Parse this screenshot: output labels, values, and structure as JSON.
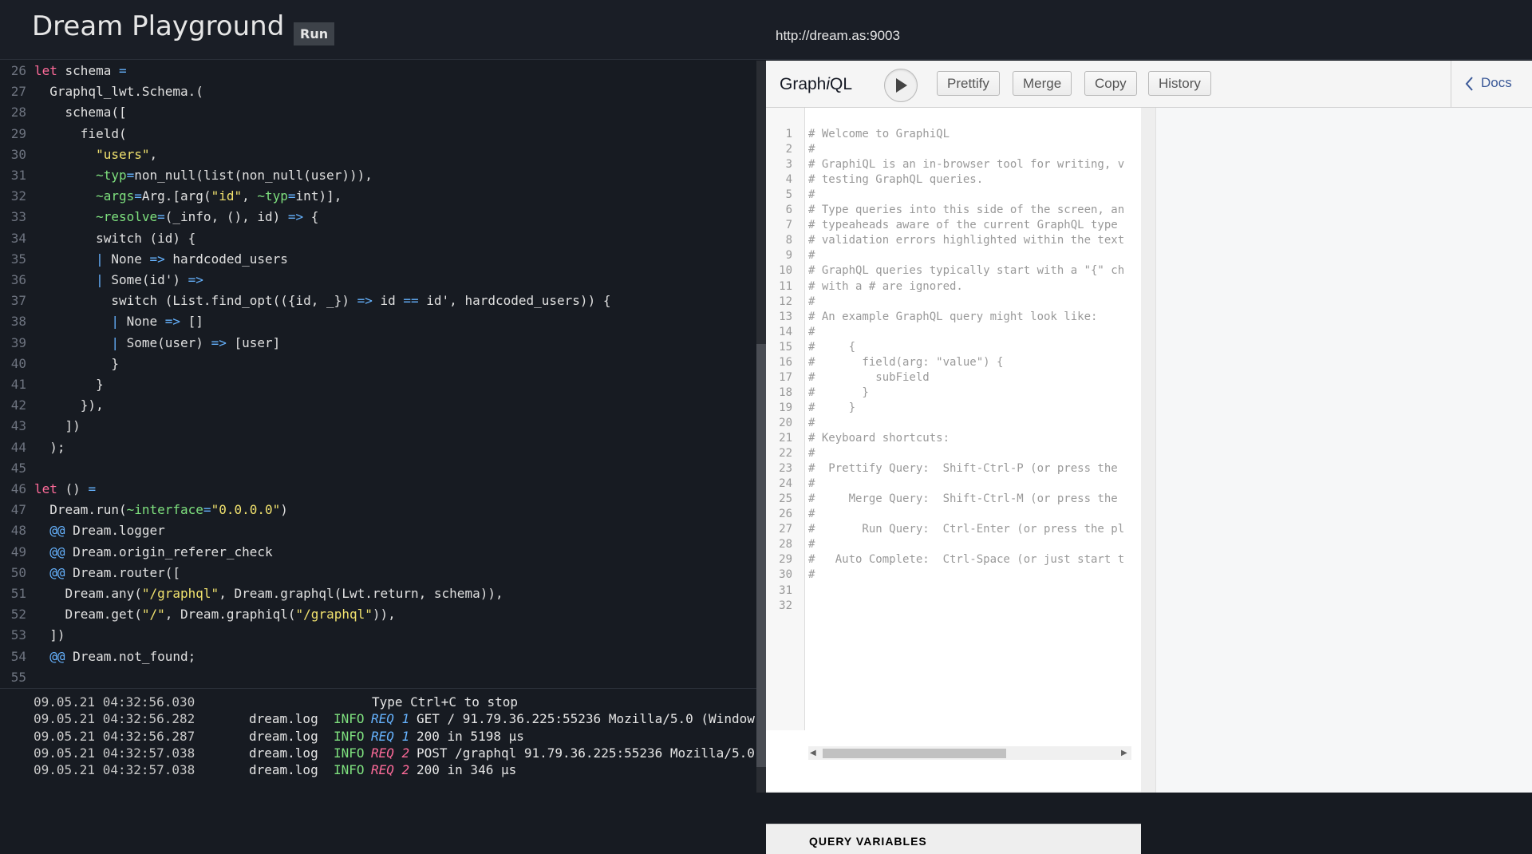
{
  "header": {
    "title": "Dream Playground",
    "run_label": "Run",
    "url": "http://dream.as:9003"
  },
  "editor": {
    "lines": [
      {
        "n": "26",
        "parts": [
          [
            "kw",
            "let"
          ],
          [
            "txt",
            " schema "
          ],
          [
            "op",
            "="
          ]
        ]
      },
      {
        "n": "27",
        "parts": [
          [
            "txt",
            "  Graphql_lwt.Schema.("
          ]
        ]
      },
      {
        "n": "28",
        "parts": [
          [
            "txt",
            "    schema(["
          ]
        ]
      },
      {
        "n": "29",
        "parts": [
          [
            "txt",
            "      field("
          ]
        ]
      },
      {
        "n": "30",
        "parts": [
          [
            "txt",
            "        "
          ],
          [
            "str",
            "\"users\""
          ],
          [
            "txt",
            ","
          ]
        ]
      },
      {
        "n": "31",
        "parts": [
          [
            "txt",
            "        "
          ],
          [
            "lab",
            "~typ"
          ],
          [
            "op",
            "="
          ],
          [
            "txt",
            "non_null(list(non_null(user))),"
          ]
        ]
      },
      {
        "n": "32",
        "parts": [
          [
            "txt",
            "        "
          ],
          [
            "lab",
            "~args"
          ],
          [
            "op",
            "="
          ],
          [
            "txt",
            "Arg.[arg("
          ],
          [
            "str",
            "\"id\""
          ],
          [
            "txt",
            ", "
          ],
          [
            "lab",
            "~typ"
          ],
          [
            "op",
            "="
          ],
          [
            "txt",
            "int)],"
          ]
        ]
      },
      {
        "n": "33",
        "parts": [
          [
            "txt",
            "        "
          ],
          [
            "lab",
            "~resolve"
          ],
          [
            "op",
            "="
          ],
          [
            "txt",
            "(_info, (), id) "
          ],
          [
            "op",
            "=>"
          ],
          [
            "txt",
            " {"
          ]
        ]
      },
      {
        "n": "34",
        "parts": [
          [
            "txt",
            "        switch (id) {"
          ]
        ]
      },
      {
        "n": "35",
        "parts": [
          [
            "txt",
            "        "
          ],
          [
            "op",
            "|"
          ],
          [
            "txt",
            " None "
          ],
          [
            "op",
            "=>"
          ],
          [
            "txt",
            " hardcoded_users"
          ]
        ]
      },
      {
        "n": "36",
        "parts": [
          [
            "txt",
            "        "
          ],
          [
            "op",
            "|"
          ],
          [
            "txt",
            " Some(id') "
          ],
          [
            "op",
            "=>"
          ]
        ]
      },
      {
        "n": "37",
        "parts": [
          [
            "txt",
            "          switch (List.find_opt(({id, _}) "
          ],
          [
            "op",
            "=>"
          ],
          [
            "txt",
            " id "
          ],
          [
            "op",
            "=="
          ],
          [
            "txt",
            " id', hardcoded_users)) {"
          ]
        ]
      },
      {
        "n": "38",
        "parts": [
          [
            "txt",
            "          "
          ],
          [
            "op",
            "|"
          ],
          [
            "txt",
            " None "
          ],
          [
            "op",
            "=>"
          ],
          [
            "txt",
            " []"
          ]
        ]
      },
      {
        "n": "39",
        "parts": [
          [
            "txt",
            "          "
          ],
          [
            "op",
            "|"
          ],
          [
            "txt",
            " Some(user) "
          ],
          [
            "op",
            "=>"
          ],
          [
            "txt",
            " [user]"
          ]
        ]
      },
      {
        "n": "40",
        "parts": [
          [
            "txt",
            "          }"
          ]
        ]
      },
      {
        "n": "41",
        "parts": [
          [
            "txt",
            "        }"
          ]
        ]
      },
      {
        "n": "42",
        "parts": [
          [
            "txt",
            "      }),"
          ]
        ]
      },
      {
        "n": "43",
        "parts": [
          [
            "txt",
            "    ])"
          ]
        ]
      },
      {
        "n": "44",
        "parts": [
          [
            "txt",
            "  );"
          ]
        ]
      },
      {
        "n": "45",
        "parts": [
          [
            "txt",
            ""
          ]
        ]
      },
      {
        "n": "46",
        "parts": [
          [
            "kw",
            "let"
          ],
          [
            "txt",
            " () "
          ],
          [
            "op",
            "="
          ]
        ]
      },
      {
        "n": "47",
        "parts": [
          [
            "txt",
            "  Dream.run("
          ],
          [
            "lab",
            "~interface"
          ],
          [
            "op",
            "="
          ],
          [
            "str",
            "\"0.0.0.0\""
          ],
          [
            "txt",
            ")"
          ]
        ]
      },
      {
        "n": "48",
        "parts": [
          [
            "txt",
            "  "
          ],
          [
            "op",
            "@@"
          ],
          [
            "txt",
            " Dream.logger"
          ]
        ]
      },
      {
        "n": "49",
        "parts": [
          [
            "txt",
            "  "
          ],
          [
            "op",
            "@@"
          ],
          [
            "txt",
            " Dream.origin_referer_check"
          ]
        ]
      },
      {
        "n": "50",
        "parts": [
          [
            "txt",
            "  "
          ],
          [
            "op",
            "@@"
          ],
          [
            "txt",
            " Dream.router(["
          ]
        ]
      },
      {
        "n": "51",
        "parts": [
          [
            "txt",
            "    Dream.any("
          ],
          [
            "str",
            "\"/graphql\""
          ],
          [
            "txt",
            ", Dream.graphql(Lwt.return, schema)),"
          ]
        ]
      },
      {
        "n": "52",
        "parts": [
          [
            "txt",
            "    Dream.get("
          ],
          [
            "str",
            "\"/\""
          ],
          [
            "txt",
            ", Dream.graphiql("
          ],
          [
            "str",
            "\"/graphql\""
          ],
          [
            "txt",
            ")),"
          ]
        ]
      },
      {
        "n": "53",
        "parts": [
          [
            "txt",
            "  ])"
          ]
        ]
      },
      {
        "n": "54",
        "parts": [
          [
            "txt",
            "  "
          ],
          [
            "op",
            "@@"
          ],
          [
            "txt",
            " Dream.not_found;"
          ]
        ]
      },
      {
        "n": "55",
        "parts": [
          [
            "txt",
            ""
          ]
        ]
      }
    ]
  },
  "log": {
    "lines": [
      {
        "time": "09.05.21 04:32:56.030",
        "source": "",
        "level": "",
        "req": "",
        "req_class": "",
        "message": "Type Ctrl+C to stop"
      },
      {
        "time": "09.05.21 04:32:56.282",
        "source": "dream.log",
        "level": "INFO",
        "req": "REQ 1",
        "req_class": "lreq1",
        "message": "GET / 91.79.36.225:55236 Mozilla/5.0 (Window"
      },
      {
        "time": "09.05.21 04:32:56.287",
        "source": "dream.log",
        "level": "INFO",
        "req": "REQ 1",
        "req_class": "lreq1",
        "message": "200 in 5198 µs"
      },
      {
        "time": "09.05.21 04:32:57.038",
        "source": "dream.log",
        "level": "INFO",
        "req": "REQ 2",
        "req_class": "lreq2",
        "message": "POST /graphql 91.79.36.225:55236 Mozilla/5.0"
      },
      {
        "time": "09.05.21 04:32:57.038",
        "source": "dream.log",
        "level": "INFO",
        "req": "REQ 2",
        "req_class": "lreq2",
        "message": "200 in 346 µs"
      }
    ]
  },
  "graphiql": {
    "title_prefix": "Graph",
    "title_italic": "i",
    "title_suffix": "QL",
    "buttons": [
      "Prettify",
      "Merge",
      "Copy",
      "History"
    ],
    "docs_label": "Docs",
    "query_vars_label": "QUERY VARIABLES",
    "query_lines": [
      "# Welcome to GraphiQL",
      "#",
      "# GraphiQL is an in-browser tool for writing, v",
      "# testing GraphQL queries.",
      "#",
      "# Type queries into this side of the screen, an",
      "# typeaheads aware of the current GraphQL type",
      "# validation errors highlighted within the text",
      "#",
      "# GraphQL queries typically start with a \"{\" ch",
      "# with a # are ignored.",
      "#",
      "# An example GraphQL query might look like:",
      "#",
      "#     {",
      "#       field(arg: \"value\") {",
      "#         subField",
      "#       }",
      "#     }",
      "#",
      "# Keyboard shortcuts:",
      "#",
      "#  Prettify Query:  Shift-Ctrl-P (or press the",
      "#",
      "#     Merge Query:  Shift-Ctrl-M (or press the",
      "#",
      "#       Run Query:  Ctrl-Enter (or press the pl",
      "#",
      "#   Auto Complete:  Ctrl-Space (or just start t",
      "#",
      "",
      ""
    ]
  }
}
